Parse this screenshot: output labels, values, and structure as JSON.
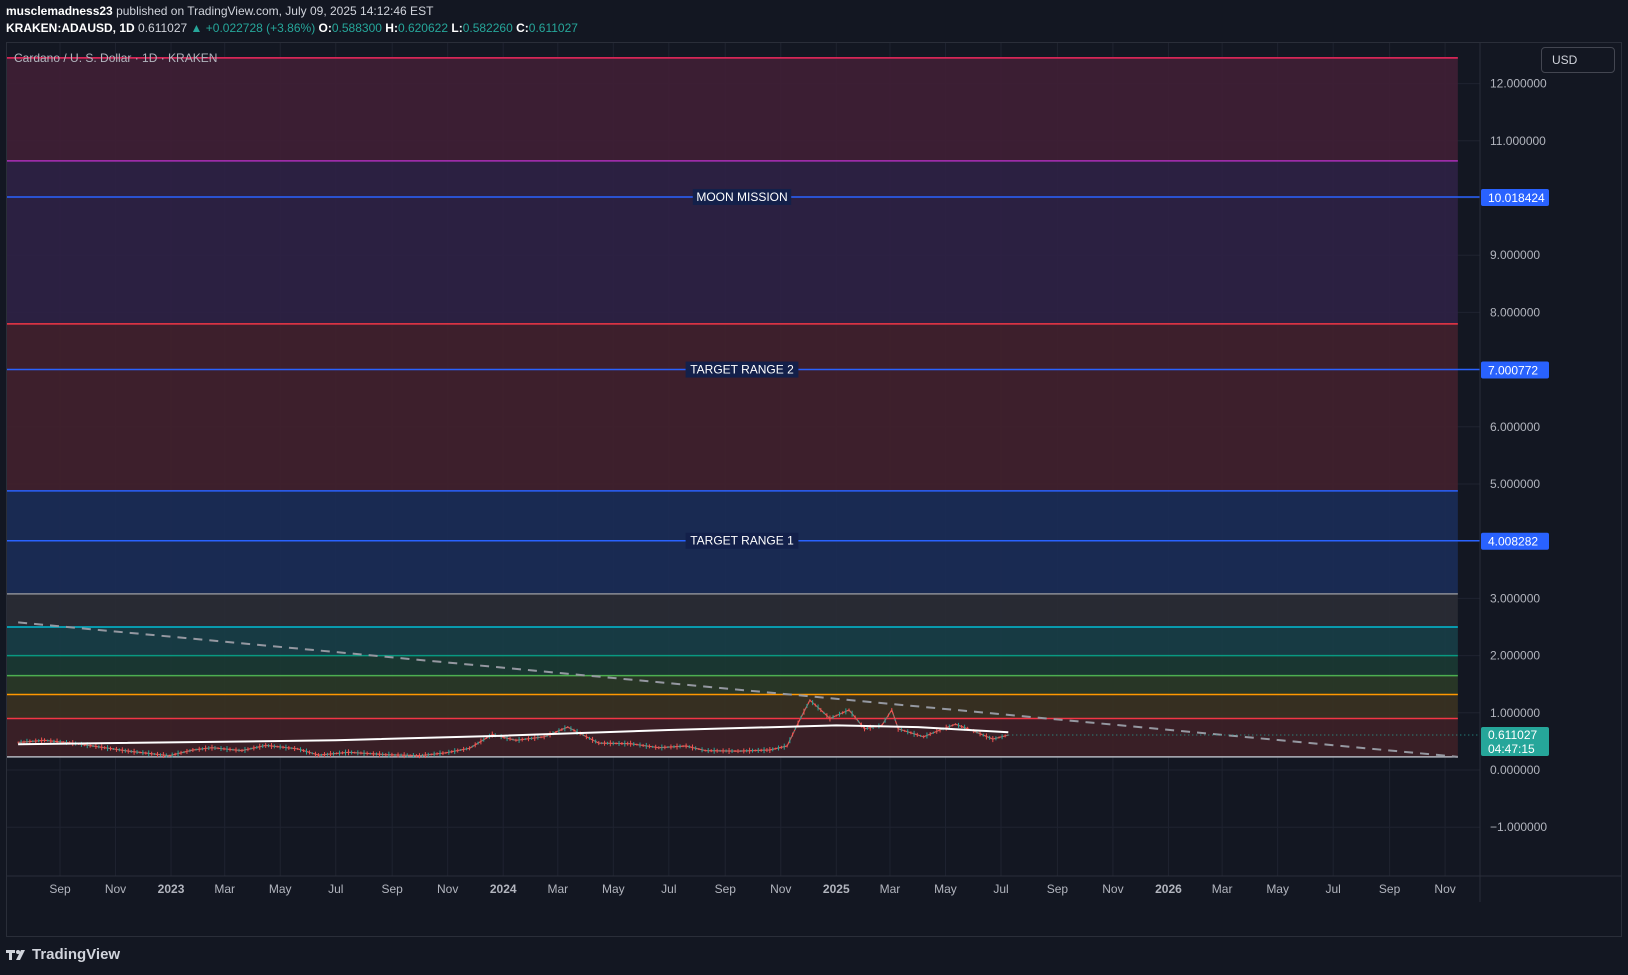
{
  "header": {
    "author": "musclemadness23",
    "published_text": "published on TradingView.com, July 09, 2025 14:12:46 EST",
    "symbol": "KRAKEN:ADAUSD, 1D",
    "last": "0.611027",
    "change_arrow": "▲",
    "change": "+0.022728 (+3.86%)",
    "o_label": "O:",
    "o": "0.588300",
    "h_label": "H:",
    "h": "0.620622",
    "l_label": "L:",
    "l": "0.582260",
    "c_label": "C:",
    "c": "0.611027"
  },
  "chart_title": "Cardano / U. S. Dollar · 1D · KRAKEN",
  "currency_button": "USD",
  "footer_brand": "TradingView",
  "colors": {
    "background": "#131722",
    "up": "#26a69a",
    "down": "#ef5350",
    "label_blue": "#2962ff"
  },
  "chart_data": {
    "type": "line",
    "x_range": [
      "2022-07-17",
      "2026-12-10"
    ],
    "ylim": [
      -1.85,
      12.7
    ],
    "y_ticks": [
      "12.000000",
      "11.000000",
      "9.000000",
      "8.000000",
      "6.000000",
      "5.000000",
      "3.000000",
      "2.000000",
      "1.000000",
      "0.000000",
      "−1.000000"
    ],
    "x_ticks": [
      {
        "label": "Sep",
        "date": "2022-09-01"
      },
      {
        "label": "Nov",
        "date": "2022-11-01"
      },
      {
        "label": "2023",
        "date": "2023-01-01",
        "bold": true
      },
      {
        "label": "Mar",
        "date": "2023-03-01"
      },
      {
        "label": "May",
        "date": "2023-05-01"
      },
      {
        "label": "Jul",
        "date": "2023-07-01"
      },
      {
        "label": "Sep",
        "date": "2023-09-01"
      },
      {
        "label": "Nov",
        "date": "2023-11-01"
      },
      {
        "label": "2024",
        "date": "2024-01-01",
        "bold": true
      },
      {
        "label": "Mar",
        "date": "2024-03-01"
      },
      {
        "label": "May",
        "date": "2024-05-01"
      },
      {
        "label": "Jul",
        "date": "2024-07-01"
      },
      {
        "label": "Sep",
        "date": "2024-09-01"
      },
      {
        "label": "Nov",
        "date": "2024-11-01"
      },
      {
        "label": "2025",
        "date": "2025-01-01",
        "bold": true
      },
      {
        "label": "Mar",
        "date": "2025-03-01"
      },
      {
        "label": "May",
        "date": "2025-05-01"
      },
      {
        "label": "Jul",
        "date": "2025-07-01"
      },
      {
        "label": "Sep",
        "date": "2025-09-01"
      },
      {
        "label": "Nov",
        "date": "2025-11-01"
      },
      {
        "label": "2026",
        "date": "2026-01-01",
        "bold": true
      },
      {
        "label": "Mar",
        "date": "2026-03-01"
      },
      {
        "label": "May",
        "date": "2026-05-01"
      },
      {
        "label": "Jul",
        "date": "2026-07-01"
      },
      {
        "label": "Sep",
        "date": "2026-09-01"
      },
      {
        "label": "Nov",
        "date": "2026-11-01"
      }
    ],
    "zones": [
      {
        "from": 10.65,
        "to": 12.45,
        "color": "#3f1f35"
      },
      {
        "from": 7.8,
        "to": 10.65,
        "color": "#2e2244"
      },
      {
        "from": 4.88,
        "to": 7.8,
        "color": "#41212e"
      },
      {
        "from": 3.08,
        "to": 4.88,
        "color": "#1a2c57"
      },
      {
        "from": 2.5,
        "to": 3.08,
        "color": "#2a2d35"
      },
      {
        "from": 2.0,
        "to": 2.5,
        "color": "#183e46"
      },
      {
        "from": 1.65,
        "to": 2.0,
        "color": "#1a3a33"
      },
      {
        "from": 1.32,
        "to": 1.65,
        "color": "#2a3a27"
      },
      {
        "from": 0.9,
        "to": 1.32,
        "color": "#3a3222"
      },
      {
        "from": 0.23,
        "to": 0.9,
        "color": "#3d2127"
      }
    ],
    "levels": [
      {
        "y": 12.45,
        "color": "#f2285e"
      },
      {
        "y": 10.65,
        "color": "#ab2fb8"
      },
      {
        "y": 7.8,
        "color": "#f23645"
      },
      {
        "y": 4.88,
        "color": "#2962ff"
      },
      {
        "y": 3.08,
        "color": "#8a8d94"
      },
      {
        "y": 2.5,
        "color": "#00bcd4"
      },
      {
        "y": 2.0,
        "color": "#089981"
      },
      {
        "y": 1.65,
        "color": "#4caf50"
      },
      {
        "y": 1.32,
        "color": "#ff9800"
      },
      {
        "y": 0.9,
        "color": "#f23645"
      },
      {
        "y": 0.23,
        "color": "#b2b5be"
      }
    ],
    "labeled_levels": [
      {
        "label": "MOON MISSION",
        "value": "10.018424",
        "y": 10.018424
      },
      {
        "label": "TARGET RANGE 2",
        "value": "7.000772",
        "y": 7.000772
      },
      {
        "label": "TARGET RANGE 1",
        "value": "4.008282",
        "y": 4.008282
      }
    ],
    "trendline": {
      "start": {
        "date": "2022-07-17",
        "y": 2.58
      },
      "end": {
        "date": "2026-11-15",
        "y": 0.23
      }
    },
    "last_price": {
      "value": "0.611027",
      "countdown": "04:47:15",
      "y": 0.611027
    },
    "price_series": [
      {
        "date": "2022-07-17",
        "y": 0.48
      },
      {
        "date": "2022-08-15",
        "y": 0.52
      },
      {
        "date": "2022-09-15",
        "y": 0.47
      },
      {
        "date": "2022-10-20",
        "y": 0.39
      },
      {
        "date": "2022-11-15",
        "y": 0.33
      },
      {
        "date": "2022-12-30",
        "y": 0.25
      },
      {
        "date": "2023-01-25",
        "y": 0.35
      },
      {
        "date": "2023-02-15",
        "y": 0.39
      },
      {
        "date": "2023-03-20",
        "y": 0.34
      },
      {
        "date": "2023-04-15",
        "y": 0.43
      },
      {
        "date": "2023-05-20",
        "y": 0.37
      },
      {
        "date": "2023-06-12",
        "y": 0.26
      },
      {
        "date": "2023-07-15",
        "y": 0.31
      },
      {
        "date": "2023-08-25",
        "y": 0.27
      },
      {
        "date": "2023-10-01",
        "y": 0.25
      },
      {
        "date": "2023-10-30",
        "y": 0.3
      },
      {
        "date": "2023-11-25",
        "y": 0.38
      },
      {
        "date": "2023-12-20",
        "y": 0.62
      },
      {
        "date": "2024-01-15",
        "y": 0.52
      },
      {
        "date": "2024-02-15",
        "y": 0.58
      },
      {
        "date": "2024-03-12",
        "y": 0.75
      },
      {
        "date": "2024-04-15",
        "y": 0.47
      },
      {
        "date": "2024-05-20",
        "y": 0.46
      },
      {
        "date": "2024-06-20",
        "y": 0.39
      },
      {
        "date": "2024-07-20",
        "y": 0.42
      },
      {
        "date": "2024-08-10",
        "y": 0.34
      },
      {
        "date": "2024-09-15",
        "y": 0.33
      },
      {
        "date": "2024-10-20",
        "y": 0.35
      },
      {
        "date": "2024-11-08",
        "y": 0.42
      },
      {
        "date": "2024-11-20",
        "y": 0.82
      },
      {
        "date": "2024-12-03",
        "y": 1.22
      },
      {
        "date": "2024-12-15",
        "y": 1.05
      },
      {
        "date": "2024-12-25",
        "y": 0.9
      },
      {
        "date": "2025-01-15",
        "y": 1.05
      },
      {
        "date": "2025-02-01",
        "y": 0.72
      },
      {
        "date": "2025-02-20",
        "y": 0.78
      },
      {
        "date": "2025-03-03",
        "y": 1.05
      },
      {
        "date": "2025-03-10",
        "y": 0.72
      },
      {
        "date": "2025-04-07",
        "y": 0.58
      },
      {
        "date": "2025-04-25",
        "y": 0.7
      },
      {
        "date": "2025-05-12",
        "y": 0.8
      },
      {
        "date": "2025-06-01",
        "y": 0.68
      },
      {
        "date": "2025-06-22",
        "y": 0.54
      },
      {
        "date": "2025-07-09",
        "y": 0.61
      }
    ],
    "moving_average": [
      {
        "date": "2022-07-17",
        "y": 0.45
      },
      {
        "date": "2023-07-01",
        "y": 0.52
      },
      {
        "date": "2024-01-01",
        "y": 0.6
      },
      {
        "date": "2024-07-01",
        "y": 0.7
      },
      {
        "date": "2025-01-01",
        "y": 0.78
      },
      {
        "date": "2025-04-01",
        "y": 0.75
      },
      {
        "date": "2025-07-09",
        "y": 0.66
      }
    ]
  }
}
